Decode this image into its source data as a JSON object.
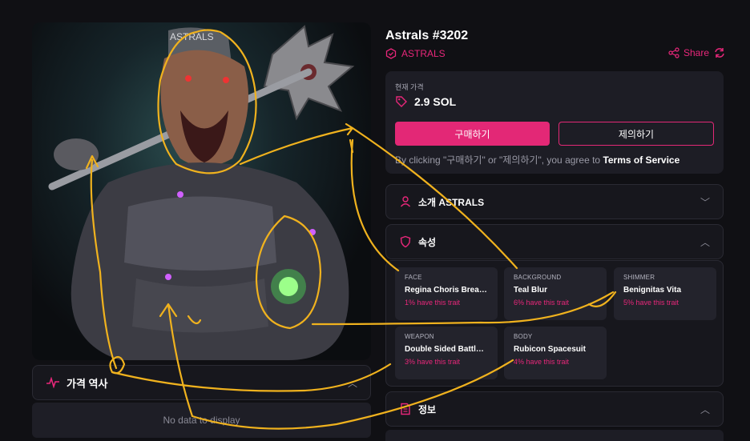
{
  "nft": {
    "title": "Astrals #3202",
    "collection": "ASTRALS",
    "share_label": "Share",
    "art_text": "ASTRALS"
  },
  "price": {
    "label": "현재 가격",
    "value": "2.9 SOL",
    "buy_label": "구매하기",
    "offer_label": "제의하기",
    "terms_prefix": "By clicking \"구매하기\" or \"제의하기\", you agree to ",
    "terms_link": "Terms of Service"
  },
  "history": {
    "title": "가격 역사",
    "empty": "No data to display"
  },
  "sections": {
    "about": "소개 ASTRALS",
    "attributes": "속성",
    "details": "정보"
  },
  "traits": [
    {
      "type": "FACE",
      "value": "Regina Choris Breakout",
      "rarity": "1% have this trait"
    },
    {
      "type": "BACKGROUND",
      "value": "Teal Blur",
      "rarity": "6% have this trait"
    },
    {
      "type": "SHIMMER",
      "value": "Benignitas Vita",
      "rarity": "5% have this trait"
    },
    {
      "type": "WEAPON",
      "value": "Double Sided Battle Axe",
      "rarity": "3% have this trait"
    },
    {
      "type": "BODY",
      "value": "Rubicon Spacesuit",
      "rarity": "4% have this trait"
    }
  ],
  "colors": {
    "accent": "#e32876",
    "annotation": "#f0b21e",
    "background": "#101014"
  }
}
